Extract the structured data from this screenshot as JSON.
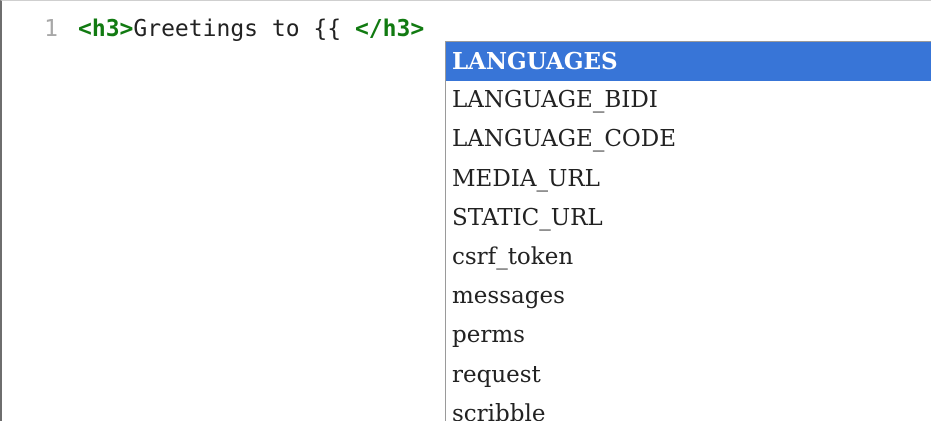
{
  "editor": {
    "line_number": "1",
    "code": {
      "open_tag": "<h3>",
      "text": "Greetings to {{ ",
      "close_tag": "</h3>"
    }
  },
  "autocomplete": {
    "selected_index": 0,
    "items": [
      "LANGUAGES",
      "LANGUAGE_BIDI",
      "LANGUAGE_CODE",
      "MEDIA_URL",
      "STATIC_URL",
      "csrf_token",
      "messages",
      "perms",
      "request",
      "scribble"
    ]
  },
  "colors": {
    "tag": "#117a11",
    "selection": "#3875d7",
    "line_number": "#a8a8a8"
  }
}
